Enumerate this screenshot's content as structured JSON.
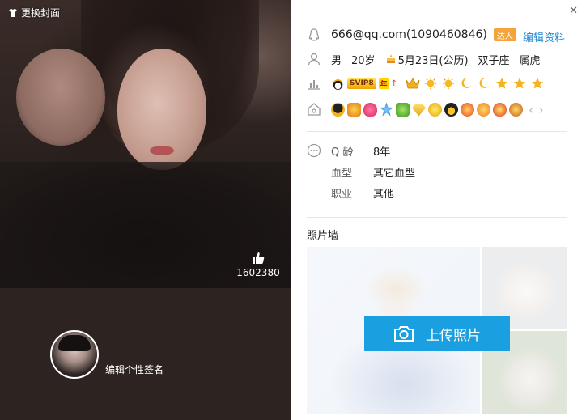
{
  "cover": {
    "change_cover_label": "更换封面",
    "like_count": "1602380"
  },
  "profile": {
    "signature_placeholder": "编辑个性签名"
  },
  "window": {
    "minimize": "–",
    "close": "✕"
  },
  "account": {
    "email_qq": "666@qq.com(1090460846)",
    "daren_badge": "达人",
    "edit_label": "编辑资料"
  },
  "basic": {
    "gender": "男",
    "age": "20岁",
    "birthday": "5月23日(公历)",
    "zodiac": "双子座",
    "chinese_zodiac": "属虎"
  },
  "vip": {
    "svip": "SVIP8",
    "year": "年",
    "arrow": "↑"
  },
  "nav": {
    "prev": "‹",
    "next": "›"
  },
  "details": {
    "qage_label": "Q 龄",
    "qage_value": "8年",
    "blood_label": "血型",
    "blood_value": "其它血型",
    "job_label": "职业",
    "job_value": "其他"
  },
  "gallery": {
    "title": "照片墙",
    "upload_label": "上传照片"
  },
  "colors": {
    "accent": "#1aa0e0",
    "link": "#1e87d0",
    "left_bg": "#2d2421"
  }
}
